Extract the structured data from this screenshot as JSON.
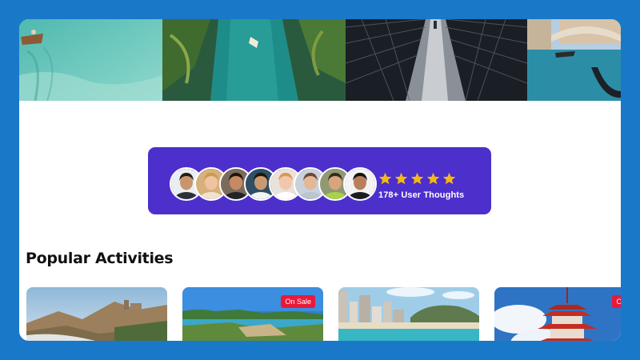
{
  "hero": {
    "tiles": [
      {
        "name": "lagoon-boat",
        "colors": {
          "top": "#5cc3bc",
          "bottom": "#7ed4c8"
        }
      },
      {
        "name": "jungle-river",
        "colors": {
          "top": "#2b5a3d",
          "bottom": "#1e8a8c"
        }
      },
      {
        "name": "rope-bridge",
        "colors": {
          "top": "#1d2228",
          "bottom": "#5b6470"
        }
      },
      {
        "name": "venice-canal",
        "colors": {
          "top": "#b9cfe0",
          "bottom": "#2b8ea7"
        }
      }
    ]
  },
  "rating": {
    "stars": 5,
    "label": "178+ User Thoughts",
    "star_color": "#f5b90f",
    "card_color": "#4d2fcc",
    "avatars": [
      {
        "name": "avatar-man-suit",
        "bg": "#e9eef2",
        "skin": "#c9956d",
        "hair": "#2a1c12",
        "shirt": "#2c3038"
      },
      {
        "name": "avatar-blonde-woman",
        "bg": "#d7b07a",
        "skin": "#efc3a1",
        "hair": "#c99a4a",
        "shirt": "#f0e2cf"
      },
      {
        "name": "avatar-man-glasses",
        "bg": "#7b6b5c",
        "skin": "#c68b63",
        "hair": "#1b1410",
        "shirt": "#222428"
      },
      {
        "name": "avatar-man-white-shirt",
        "bg": "#2f4f64",
        "skin": "#c99a72",
        "hair": "#20160f",
        "shirt": "#f4f4f4"
      },
      {
        "name": "avatar-smiling-woman",
        "bg": "#e8e2da",
        "skin": "#f2c7a9",
        "hair": "#d8975b",
        "shirt": "#ffffff"
      },
      {
        "name": "avatar-woman-window",
        "bg": "#c8d1dc",
        "skin": "#e4b896",
        "hair": "#6a4a36",
        "shirt": "#b9c5d1"
      },
      {
        "name": "avatar-woman-green",
        "bg": "#8f9a74",
        "skin": "#d8a57e",
        "hair": "#3a2a1c",
        "shirt": "#a8d24a"
      },
      {
        "name": "avatar-bearded-man",
        "bg": "#f3f3f3",
        "skin": "#b97f5a",
        "hair": "#151010",
        "shirt": "#1c1d22"
      }
    ]
  },
  "activities": {
    "title": "Popular Activities",
    "cards": [
      {
        "name": "mountain-castle",
        "on_sale": false,
        "badge": ""
      },
      {
        "name": "coastal-cliffs",
        "on_sale": true,
        "badge": "On Sale"
      },
      {
        "name": "beach-city",
        "on_sale": false,
        "badge": ""
      },
      {
        "name": "japanese-pagoda",
        "on_sale": true,
        "badge": "On Sale"
      }
    ]
  }
}
